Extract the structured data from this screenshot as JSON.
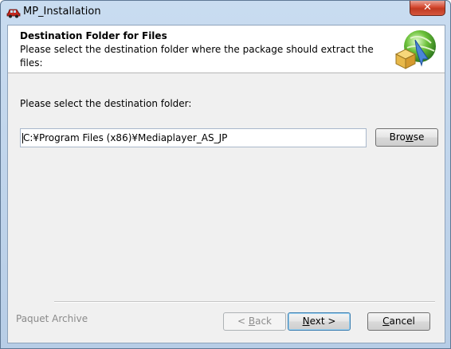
{
  "window": {
    "title": "MP_Installation",
    "close_symbol": "✕",
    "icon": "car-icon"
  },
  "header": {
    "title": "Destination Folder for Files",
    "subtitle": "Please select the destination folder where the package should extract the files:",
    "logo": "package-globe-icon"
  },
  "main": {
    "prompt": "Please select the destination folder:",
    "path_value": "C:¥Program Files (x86)¥Mediaplayer_AS_JP",
    "browse_pre": "Bro",
    "browse_mnemonic": "w",
    "browse_post": "se"
  },
  "footer": {
    "brand": "Paquet Archive",
    "back_pre": "< ",
    "back_mnemonic": "B",
    "back_post": "ack",
    "next_mnemonic": "N",
    "next_post": "ext >",
    "cancel_mnemonic": "C",
    "cancel_post": "ancel"
  },
  "colors": {
    "frame": "#c9dcf0",
    "close": "#d5472f",
    "default_button_border": "#3c7fb1"
  }
}
